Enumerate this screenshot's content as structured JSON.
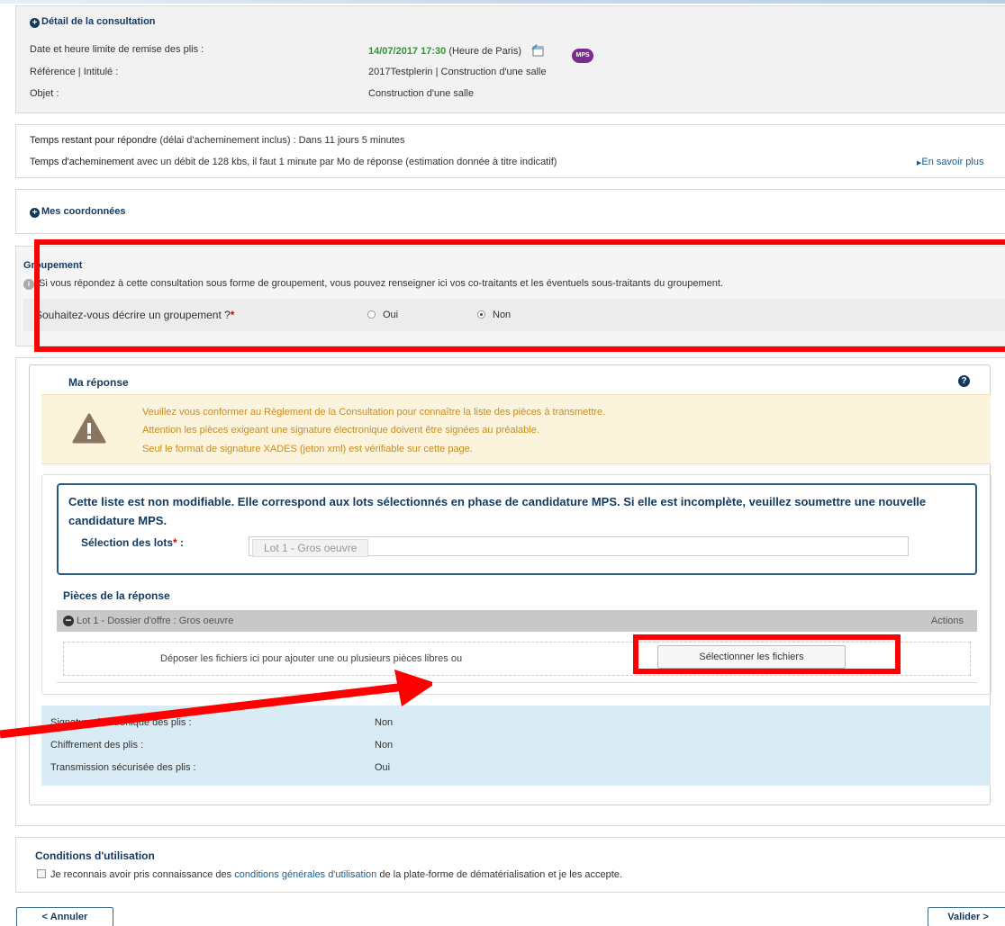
{
  "consultation": {
    "title": "Détail de la consultation",
    "deadline_label": "Date et heure limite de remise des plis :",
    "deadline_value": "14/07/2017 17:30",
    "deadline_tz": "(Heure de Paris)",
    "mps_badge": "MPS",
    "reference_label": "Référence | Intitulé :",
    "reference_value": "2017Testplerin | Construction d'une salle",
    "objet_label": "Objet :",
    "objet_value": "Construction d'une salle"
  },
  "timing": {
    "remaining_label": "Temps restant pour répondre",
    "remaining_detail": "(délai d'acheminement inclus) : Dans 11 jours 5 minutes",
    "transfer_label": "Temps d'acheminement",
    "transfer_detail": "avec un débit de 128 kbs, il faut 1 minute par Mo de réponse (estimation donnée à titre indicatif)",
    "more_link": "En savoir plus"
  },
  "coordonnees": {
    "title": "Mes coordonnées"
  },
  "groupement": {
    "title": "Groupement",
    "info": "Si vous répondez à cette consultation sous forme de groupement, vous pouvez renseigner ici vos co-traitants et les éventuels sous-traitants du groupement.",
    "question": "Souhaitez-vous décrire un groupement ?",
    "required_mark": "*",
    "option_yes": "Oui",
    "option_no": "Non",
    "selected": "Non"
  },
  "reponse": {
    "title": "Ma réponse",
    "warning_lines": [
      "Veuillez vous conformer au Règlement de la Consultation pour connaître la liste des pièces à transmettre.",
      "Attention les pièces exigeant une signature électronique doivent être signées au préalable.",
      "Seul le format de signature XADES (jeton xml) est vérifiable sur cette page."
    ],
    "lots_notice": "Cette liste est non modifiable. Elle correspond aux lots sélectionnés en phase de candidature MPS. Si elle est incomplète, veuillez soumettre une nouvelle candidature MPS.",
    "lots_label": "Sélection des lots",
    "lots_required": "*",
    "lots_colon": ":",
    "lots_value": "Lot 1 - Gros oeuvre",
    "pieces_title": "Pièces de la réponse",
    "lot_header": "Lot 1 - Dossier d'offre : Gros oeuvre",
    "actions_label": "Actions",
    "drop_text": "Déposer les fichiers ici pour ajouter une ou plusieurs pièces libres ou",
    "select_button": "Sélectionner les fichiers",
    "signature_label": "Signature électronique des plis :",
    "signature_value": "Non",
    "chiffrement_label": "Chiffrement des plis :",
    "chiffrement_value": "Non",
    "transmission_label": "Transmission sécurisée des plis :",
    "transmission_value": "Oui"
  },
  "conditions": {
    "title": "Conditions d'utilisation",
    "text_before": "Je reconnais avoir pris connaissance des",
    "link": "conditions générales d'utilisation",
    "text_after": "de la plate-forme de dématérialisation et je les accepte."
  },
  "footer": {
    "cancel": "< Annuler",
    "validate": "Valider >"
  },
  "colors": {
    "highlight": "#ff0000",
    "deadline": "#2c9a2c",
    "heading": "#12395f",
    "warning_bg": "#fcf3dc",
    "warning_text": "#c98d1a",
    "summary_bg": "#d9ebf5"
  }
}
